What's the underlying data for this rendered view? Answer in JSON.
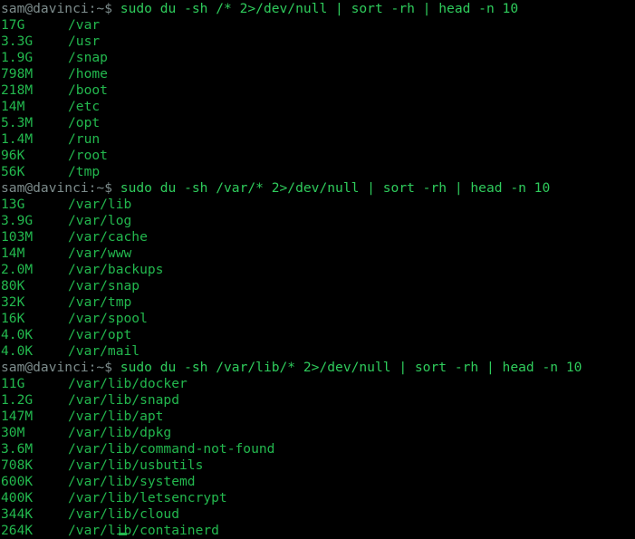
{
  "terminal": {
    "background_color": "#000000",
    "prompt_color": "#7d8c8c",
    "command_color": "#2fcc5c",
    "output_color": "#23b84e",
    "cursor_color": "#23b84e",
    "prompt": "sam@davinci:~$",
    "blocks": [
      {
        "command": " sudo du -sh /* 2>/dev/null | sort -rh | head -n 10",
        "rows": [
          {
            "size": "17G",
            "path": "/var"
          },
          {
            "size": "3.3G",
            "path": "/usr"
          },
          {
            "size": "1.9G",
            "path": "/snap"
          },
          {
            "size": "798M",
            "path": "/home"
          },
          {
            "size": "218M",
            "path": "/boot"
          },
          {
            "size": "14M",
            "path": "/etc"
          },
          {
            "size": "5.3M",
            "path": "/opt"
          },
          {
            "size": "1.4M",
            "path": "/run"
          },
          {
            "size": "96K",
            "path": "/root"
          },
          {
            "size": "56K",
            "path": "/tmp"
          }
        ]
      },
      {
        "command": " sudo du -sh /var/* 2>/dev/null | sort -rh | head -n 10",
        "rows": [
          {
            "size": "13G",
            "path": "/var/lib"
          },
          {
            "size": "3.9G",
            "path": "/var/log"
          },
          {
            "size": "103M",
            "path": "/var/cache"
          },
          {
            "size": "14M",
            "path": "/var/www"
          },
          {
            "size": "2.0M",
            "path": "/var/backups"
          },
          {
            "size": "80K",
            "path": "/var/snap"
          },
          {
            "size": "32K",
            "path": "/var/tmp"
          },
          {
            "size": "16K",
            "path": "/var/spool"
          },
          {
            "size": "4.0K",
            "path": "/var/opt"
          },
          {
            "size": "4.0K",
            "path": "/var/mail"
          }
        ]
      },
      {
        "command": " sudo du -sh /var/lib/* 2>/dev/null | sort -rh | head -n 10",
        "rows": [
          {
            "size": "11G",
            "path": "/var/lib/docker"
          },
          {
            "size": "1.2G",
            "path": "/var/lib/snapd"
          },
          {
            "size": "147M",
            "path": "/var/lib/apt"
          },
          {
            "size": "30M",
            "path": "/var/lib/dpkg"
          },
          {
            "size": "3.6M",
            "path": "/var/lib/command-not-found"
          },
          {
            "size": "708K",
            "path": "/var/lib/usbutils"
          },
          {
            "size": "600K",
            "path": "/var/lib/systemd"
          },
          {
            "size": "400K",
            "path": "/var/lib/letsencrypt"
          },
          {
            "size": "344K",
            "path": "/var/lib/cloud"
          },
          {
            "size": "264K",
            "path": "/var/lib/containerd"
          }
        ]
      }
    ]
  }
}
